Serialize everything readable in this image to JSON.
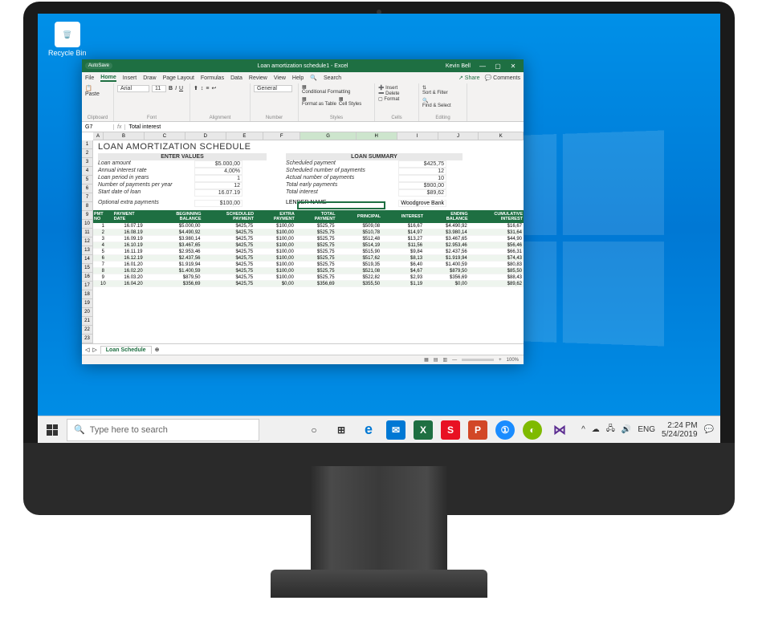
{
  "desktop": {
    "recycle_bin": "Recycle Bin",
    "search_placeholder": "Type here to search",
    "taskbar_apps": [
      "cortana",
      "timeline",
      "edge",
      "mail",
      "excel",
      "security",
      "powerpoint",
      "1password",
      "app",
      "visualstudio"
    ],
    "tray": {
      "lang": "ENG",
      "time": "2:24 PM",
      "date": "5/24/2019"
    }
  },
  "excel": {
    "autosave": "AutoSave",
    "title": "Loan amortization schedule1 - Excel",
    "user": "Kevin Bell",
    "tabs": [
      "File",
      "Home",
      "Insert",
      "Draw",
      "Page Layout",
      "Formulas",
      "Data",
      "Review",
      "View",
      "Help"
    ],
    "active_tab": "Home",
    "search_label": "Search",
    "share": "Share",
    "comments": "Comments",
    "ribbon": {
      "clipboard": "Clipboard",
      "paste": "Paste",
      "font_group": "Font",
      "font_name": "Arial",
      "font_size": "11",
      "alignment": "Alignment",
      "number": "Number",
      "number_format": "General",
      "styles": "Styles",
      "cond_fmt": "Conditional Formatting",
      "fmt_table": "Format as Table",
      "cell_styles": "Cell Styles",
      "cells": "Cells",
      "insert": "Insert",
      "delete": "Delete",
      "format": "Format",
      "editing": "Editing",
      "sort": "Sort & Filter",
      "find": "Find & Select"
    },
    "name_box": "G7",
    "formula": "Total interest",
    "sheet_tab": "Loan Schedule",
    "zoom": "100%",
    "columns": [
      "A",
      "B",
      "C",
      "D",
      "E",
      "F",
      "G",
      "H",
      "I",
      "J",
      "K"
    ]
  },
  "doc": {
    "title": "LOAN AMORTIZATION SCHEDULE",
    "enter_values": "ENTER VALUES",
    "loan_summary": "LOAN SUMMARY",
    "inputs": [
      {
        "label": "Loan amount",
        "value": "$5.000,00"
      },
      {
        "label": "Annual interest rate",
        "value": "4,00%"
      },
      {
        "label": "Loan period in years",
        "value": "1"
      },
      {
        "label": "Number of payments per year",
        "value": "12"
      },
      {
        "label": "Start date of loan",
        "value": "16.07.19"
      }
    ],
    "optional_extra": {
      "label": "Optional extra payments",
      "value": "$100,00"
    },
    "summary": [
      {
        "label": "Scheduled payment",
        "value": "$425,75"
      },
      {
        "label": "Scheduled number of payments",
        "value": "12"
      },
      {
        "label": "Actual number of payments",
        "value": "10"
      },
      {
        "label": "Total early payments",
        "value": "$900,00"
      },
      {
        "label": "Total interest",
        "value": "$89,62"
      }
    ],
    "lender_label": "LENDER NAME",
    "lender_name": "Woodgrove Bank",
    "table": {
      "headers": [
        "PMT NO",
        "PAYMENT DATE",
        "BEGINNING BALANCE",
        "SCHEDULED PAYMENT",
        "EXTRA PAYMENT",
        "TOTAL PAYMENT",
        "PRINCIPAL",
        "INTEREST",
        "ENDING BALANCE",
        "CUMULATIVE INTEREST"
      ],
      "rows": [
        [
          "1",
          "16.07.19",
          "$5.000,00",
          "$425,75",
          "$100,00",
          "$525,75",
          "$509,08",
          "$16,67",
          "$4.490,92",
          "$16,67"
        ],
        [
          "2",
          "16.08.19",
          "$4.490,92",
          "$425,75",
          "$100,00",
          "$525,75",
          "$510,78",
          "$14,97",
          "$3.980,14",
          "$31,64"
        ],
        [
          "3",
          "16.09.19",
          "$3.980,14",
          "$425,75",
          "$100,00",
          "$525,75",
          "$512,48",
          "$13,27",
          "$3.467,65",
          "$44,90"
        ],
        [
          "4",
          "16.10.19",
          "$3.467,65",
          "$425,75",
          "$100,00",
          "$525,75",
          "$514,19",
          "$11,56",
          "$2.953,46",
          "$56,46"
        ],
        [
          "5",
          "16.11.19",
          "$2.953,46",
          "$425,75",
          "$100,00",
          "$525,75",
          "$515,90",
          "$9,84",
          "$2.437,56",
          "$66,31"
        ],
        [
          "6",
          "16.12.19",
          "$2.437,56",
          "$425,75",
          "$100,00",
          "$525,75",
          "$517,62",
          "$8,13",
          "$1.919,94",
          "$74,43"
        ],
        [
          "7",
          "16.01.20",
          "$1.919,94",
          "$425,75",
          "$100,00",
          "$525,75",
          "$519,35",
          "$6,40",
          "$1.400,59",
          "$80,83"
        ],
        [
          "8",
          "16.02.20",
          "$1.400,59",
          "$425,75",
          "$100,00",
          "$525,75",
          "$521,08",
          "$4,67",
          "$879,50",
          "$85,50"
        ],
        [
          "9",
          "16.03.20",
          "$879,50",
          "$425,75",
          "$100,00",
          "$525,75",
          "$522,82",
          "$2,93",
          "$356,69",
          "$88,43"
        ],
        [
          "10",
          "16.04.20",
          "$356,69",
          "$425,75",
          "$0,00",
          "$356,69",
          "$355,50",
          "$1,19",
          "$0,00",
          "$89,62"
        ]
      ]
    }
  }
}
